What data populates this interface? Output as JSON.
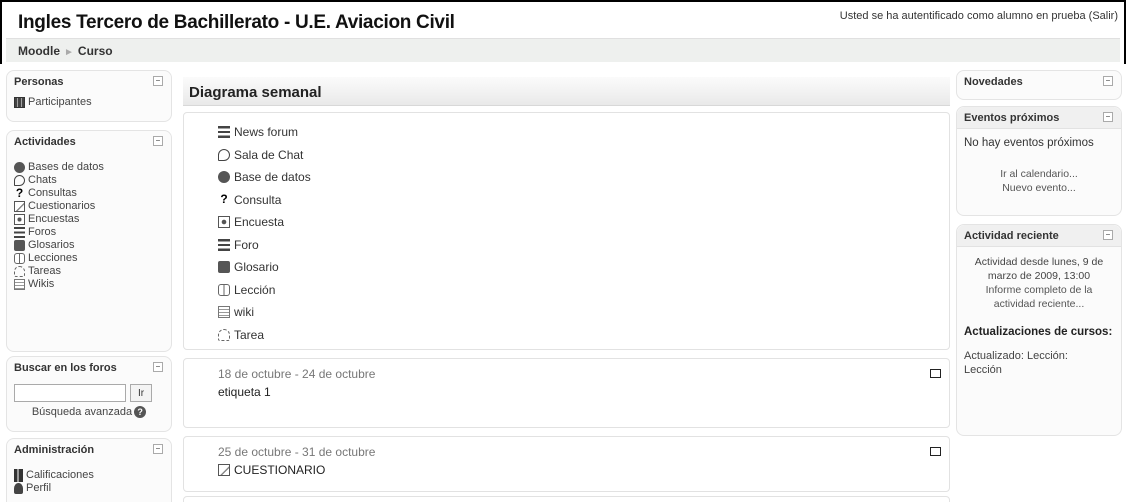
{
  "header": {
    "site_title": "Ingles Tercero de Bachillerato - U.E. Aviacion Civil",
    "login_info": "Usted se ha autentificado como alumno en prueba (Salir)"
  },
  "breadcrumb": {
    "home": "Moodle",
    "separator": "►",
    "current": "Curso"
  },
  "left": {
    "personas": {
      "title": "Personas",
      "toggle": "–",
      "items": [
        {
          "label": "Participantes",
          "icon": "participants-icon"
        }
      ]
    },
    "actividades": {
      "title": "Actividades",
      "toggle": "–",
      "items": [
        {
          "label": "Bases de datos",
          "icon": "database-icon"
        },
        {
          "label": "Chats",
          "icon": "chat-icon"
        },
        {
          "label": "Consultas",
          "icon": "choice-icon"
        },
        {
          "label": "Cuestionarios",
          "icon": "quiz-icon"
        },
        {
          "label": "Encuestas",
          "icon": "survey-icon"
        },
        {
          "label": "Foros",
          "icon": "forum-icon"
        },
        {
          "label": "Glosarios",
          "icon": "glossary-icon"
        },
        {
          "label": "Lecciones",
          "icon": "lesson-icon"
        },
        {
          "label": "Tareas",
          "icon": "assignment-icon"
        },
        {
          "label": "Wikis",
          "icon": "wiki-icon"
        }
      ]
    },
    "buscar": {
      "title": "Buscar en los foros",
      "toggle": "–",
      "search_value": "",
      "button_label": "Ir",
      "advanced_label": "Búsqueda avanzada",
      "help_glyph": "?"
    },
    "administracion": {
      "title": "Administración",
      "toggle": "–",
      "items": [
        {
          "label": "Calificaciones",
          "icon": "grades-icon"
        },
        {
          "label": "Perfil",
          "icon": "profile-icon"
        }
      ]
    }
  },
  "center": {
    "heading": "Diagrama semanal",
    "activities": [
      {
        "label": "News forum",
        "icon": "forum-icon"
      },
      {
        "label": "Sala de Chat",
        "icon": "chat-icon"
      },
      {
        "label": "Base de datos",
        "icon": "database-icon"
      },
      {
        "label": "Consulta",
        "icon": "choice-icon"
      },
      {
        "label": "Encuesta",
        "icon": "survey-icon"
      },
      {
        "label": "Foro",
        "icon": "forum-icon"
      },
      {
        "label": "Glosario",
        "icon": "glossary-icon"
      },
      {
        "label": "Lección",
        "icon": "lesson-icon"
      },
      {
        "label": "wiki",
        "icon": "wiki-icon"
      },
      {
        "label": "Tarea",
        "icon": "assignment-icon"
      }
    ],
    "weeks": [
      {
        "date": "18 de octubre - 24 de octubre",
        "item": "etiqueta 1",
        "icon": ""
      },
      {
        "date": "25 de octubre - 31 de octubre",
        "item": "CUESTIONARIO",
        "icon": "quiz-icon"
      }
    ]
  },
  "right": {
    "novedades": {
      "title": "Novedades",
      "toggle": "–"
    },
    "eventos": {
      "title": "Eventos próximos",
      "toggle": "–",
      "empty_text": "No hay eventos próximos",
      "calendar_link": "Ir al calendario...",
      "new_event_link": "Nuevo evento..."
    },
    "actividad": {
      "title": "Actividad reciente",
      "toggle": "–",
      "since_text": "Actividad desde lunes, 9 de marzo de 2009, 13:00",
      "full_report_link": "Informe completo de la actividad reciente...",
      "updates_heading": "Actualizaciones de cursos:",
      "update_text": "Actualizado: Lección:",
      "update_link": "Lección"
    }
  }
}
